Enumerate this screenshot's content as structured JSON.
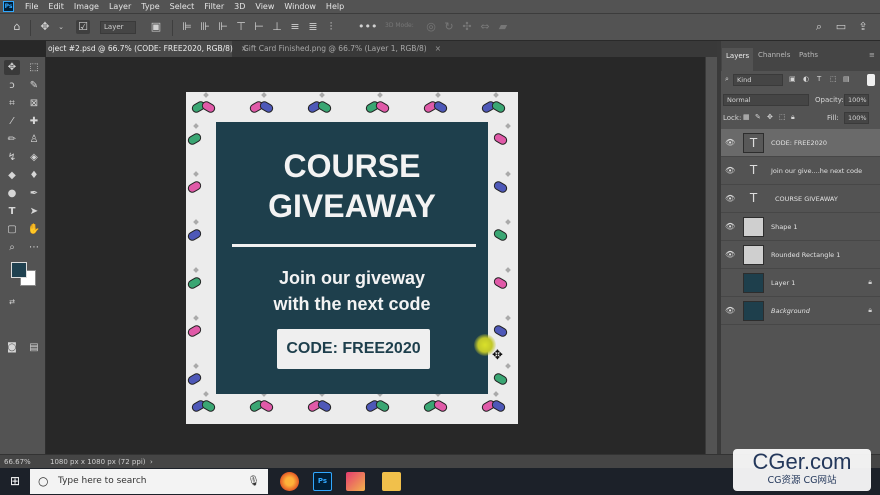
{
  "menubar": {
    "logo": "Ps",
    "items": [
      "File",
      "Edit",
      "Image",
      "Layer",
      "Type",
      "Select",
      "Filter",
      "3D",
      "View",
      "Window",
      "Help"
    ]
  },
  "options": {
    "layer_select": "Layer",
    "mode_3d": "3D Mode:"
  },
  "tabs": [
    {
      "label": "oject #2.psd @ 66.7% (CODE: FREE2020, RGB/8)",
      "close": "×",
      "active": true
    },
    {
      "label": "Gift Card Finished.png @ 66.7% (Layer 1, RGB/8)",
      "close": "×",
      "active": false
    }
  ],
  "canvas": {
    "title_line1": "COURSE",
    "title_line2": "GIVEAWAY",
    "subtitle_line1": "Join our giveway",
    "subtitle_line2": "with the next code",
    "code": "CODE: FREE2020",
    "colors": {
      "card": "#1e3f4c",
      "border": "#ececec",
      "green": "#3aa673",
      "pink": "#e05aa8",
      "blue": "#4e58b8"
    }
  },
  "panel": {
    "tabs": [
      "Layers",
      "Channels",
      "Paths"
    ],
    "kind": "Kind",
    "blend_mode": "Normal",
    "opacity_label": "Opacity:",
    "opacity": "100%",
    "lock_label": "Lock:",
    "fill_label": "Fill:",
    "fill": "100%",
    "layers": [
      {
        "name": "CODE: FREE2020",
        "type": "text",
        "selected": true
      },
      {
        "name": "Join our give....he next code",
        "type": "text"
      },
      {
        "name": "COURSE  GIVEAWAY",
        "type": "text"
      },
      {
        "name": "Shape 1",
        "type": "shape"
      },
      {
        "name": "Rounded Rectangle 1",
        "type": "shape"
      },
      {
        "name": "Layer 1",
        "type": "image",
        "locked": true
      },
      {
        "name": "Background",
        "type": "image",
        "italic": true,
        "locked": true
      }
    ]
  },
  "status": {
    "zoom": "66.67%",
    "doc_size": "1080 px x 1080 px (72 ppi)"
  },
  "taskbar": {
    "search_placeholder": "Type here to search"
  },
  "watermark": {
    "line1": "CGer.com",
    "line2": "CG资源 CG网站"
  }
}
